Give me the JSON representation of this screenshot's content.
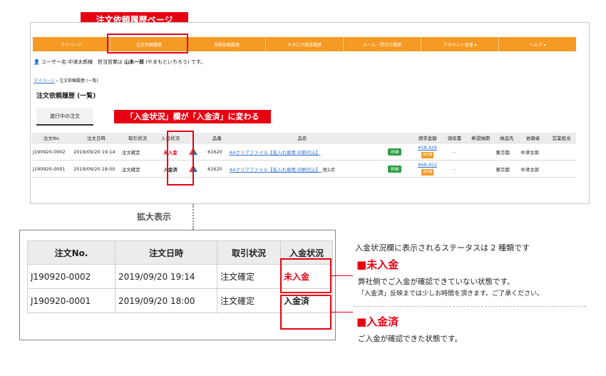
{
  "top_label": "注文依頼履歴ページ",
  "nav": {
    "items": [
      "マイページ",
      "注文依頼履歴",
      "見積依頼履歴",
      "カタログ請求履歴",
      "メール・問合せ履歴",
      "アカウント管理 ▾",
      "ヘルプ ▾"
    ],
    "active_index": 1,
    "color": "#f59a23"
  },
  "user_line": {
    "user_label": "ユーザー名:中津太郎様",
    "rep_prefix": "担当営業は",
    "rep_name": "山本一郎",
    "rep_suffix": "(やまもといちろう) です。"
  },
  "breadcrumb": {
    "home": "マイページ",
    "separator": "›",
    "current": "注文依頼履歴 (一覧)"
  },
  "page_title": "注文依頼履歴 (一覧)",
  "tab_active": "進行中の注文",
  "callout_change": "「入金状況」欄が「入金済」に変わる",
  "table": {
    "headers": [
      "注文No.",
      "注文日時",
      "取引状況",
      "入金状況",
      "",
      "品番",
      "品名",
      "",
      "請求金額",
      "領収書",
      "希望納期",
      "納品先",
      "依頼者",
      "営業担当"
    ],
    "rows": [
      {
        "order_no": "J190920-0002",
        "date": "2019/09/20 19:14",
        "status": "注文確定",
        "payment": "未入金",
        "part_no": "61620",
        "product": "A4クリアファイル【名入れ専用 印刷代込】",
        "product_extra": "",
        "detail": "詳細",
        "amount": "¥58,428",
        "amount_badge": "請求書",
        "receipt": "-",
        "delivery_to": "東京都",
        "requester": "中津太郎"
      },
      {
        "order_no": "J190920-0001",
        "date": "2019/09/20 18:00",
        "status": "注文確定",
        "payment": "入金済",
        "part_no": "61620",
        "product": "A4クリアファイル【名入れ専用 印刷代込】",
        "product_extra": "_他1点",
        "detail": "詳細",
        "amount": "¥68,452",
        "amount_badge": "請求書",
        "receipt": "-",
        "delivery_to": "東京都",
        "requester": "中津太郎"
      }
    ]
  },
  "zoom_label": "拡大表示",
  "zoom_table": {
    "headers": [
      "注文No.",
      "注文日時",
      "取引状況",
      "入金状況"
    ],
    "rows": [
      [
        "J190920-0002",
        "2019/09/20 19:14",
        "注文確定",
        "未入金"
      ],
      [
        "J190920-0001",
        "2019/09/20 18:00",
        "注文確定",
        "入金済"
      ]
    ]
  },
  "explain": {
    "intro": "入金状況欄に表示されるステータスは 2 種類です",
    "unpaid_title": "■未入金",
    "unpaid_desc": "弊社側でご入金が確認できていない状態です。",
    "unpaid_note": "「入金済」反映までは少しお時間を頂きます。ご了承ください。",
    "paid_title": "■入金済",
    "paid_desc": "ご入金が確認できた状態です。",
    "accent_color": "#e60012"
  }
}
